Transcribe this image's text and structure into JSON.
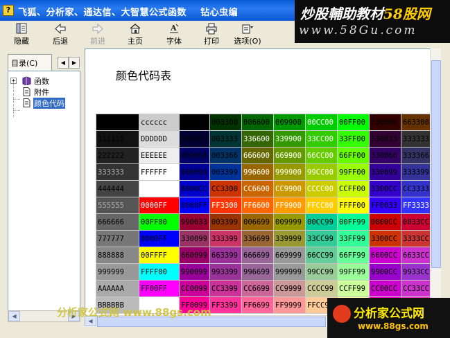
{
  "window": {
    "app_icon": "?",
    "title": "飞狐、分析家、通达信、大智慧公式函数    钻心虫编"
  },
  "banner": {
    "line1_a": "炒股輔助教材",
    "line1_b": "58股网",
    "line2": "www.58Gu.com"
  },
  "toolbar": {
    "items": [
      {
        "label": "隐藏",
        "icon": "hide-icon",
        "enabled": true
      },
      {
        "label": "后退",
        "icon": "back-arrow-icon",
        "enabled": true
      },
      {
        "label": "前进",
        "icon": "forward-arrow-icon",
        "enabled": false
      },
      {
        "label": "主页",
        "icon": "home-icon",
        "enabled": true
      },
      {
        "label": "字体",
        "icon": "font-icon",
        "enabled": true
      },
      {
        "label": "打印",
        "icon": "print-icon",
        "enabled": true
      },
      {
        "label": "选项(O)",
        "icon": "options-icon",
        "enabled": true
      }
    ]
  },
  "sidebar": {
    "tab_label": "目录(C)",
    "tree": [
      {
        "label": "函数",
        "icon": "book-icon",
        "expandable": true,
        "selected": false
      },
      {
        "label": "附件",
        "icon": "page-icon",
        "expandable": false,
        "selected": false
      },
      {
        "label": "颜色代码",
        "icon": "page-icon",
        "expandable": false,
        "selected": true
      }
    ]
  },
  "content": {
    "title": "颜色代码表",
    "rows": [
      [
        [
          "",
          "#000000",
          "#000"
        ],
        [
          "cccccc",
          "#cccccc",
          "#000"
        ],
        [
          "",
          "#000000",
          "#000"
        ],
        [
          "003300",
          "#003300",
          "#000"
        ],
        [
          "006600",
          "#006600",
          "#000"
        ],
        [
          "009900",
          "#009900",
          "#000"
        ],
        [
          "00CC00",
          "#00cc00",
          "#fff"
        ],
        [
          "00FF00",
          "#00ff00",
          "#000"
        ],
        [
          "330000",
          "#330000",
          "#000"
        ],
        [
          "663300",
          "#663300",
          "#000"
        ]
      ],
      [
        [
          "111111",
          "#111111",
          "#000"
        ],
        [
          "DDDDDD",
          "#dddddd",
          "#000"
        ],
        [
          "000033",
          "#000033",
          "#000"
        ],
        [
          "003333",
          "#003333",
          "#000"
        ],
        [
          "336600",
          "#336600",
          "#fff"
        ],
        [
          "339900",
          "#339900",
          "#fff"
        ],
        [
          "33CC00",
          "#33cc00",
          "#fff"
        ],
        [
          "33FF00",
          "#33ff00",
          "#000"
        ],
        [
          "330033",
          "#330033",
          "#000"
        ],
        [
          "333333",
          "#333333",
          "#000"
        ]
      ],
      [
        [
          "222222",
          "#222222",
          "#000"
        ],
        [
          "EEEEEE",
          "#eeeeee",
          "#000"
        ],
        [
          "000066",
          "#000066",
          "#000"
        ],
        [
          "003366",
          "#003366",
          "#000"
        ],
        [
          "666600",
          "#666600",
          "#fff"
        ],
        [
          "669900",
          "#669900",
          "#fff"
        ],
        [
          "66CC00",
          "#66cc00",
          "#fff"
        ],
        [
          "66FF00",
          "#66ff00",
          "#000"
        ],
        [
          "330066",
          "#330066",
          "#000"
        ],
        [
          "333366",
          "#333366",
          "#000"
        ]
      ],
      [
        [
          "333333",
          "#333333",
          "#aaa"
        ],
        [
          "FFFFFF",
          "#ffffff",
          "#000"
        ],
        [
          "000099",
          "#000099",
          "#000"
        ],
        [
          "003399",
          "#003399",
          "#000"
        ],
        [
          "996600",
          "#996600",
          "#fff"
        ],
        [
          "999900",
          "#999900",
          "#fff"
        ],
        [
          "99CC00",
          "#99cc00",
          "#fff"
        ],
        [
          "99FF00",
          "#99ff00",
          "#000"
        ],
        [
          "330099",
          "#330099",
          "#000"
        ],
        [
          "333399",
          "#333399",
          "#000"
        ]
      ],
      [
        [
          "444444",
          "#444444",
          "#000"
        ],
        [
          "",
          "#ffffff",
          "#000"
        ],
        [
          "0000CC",
          "#0000cc",
          "#000"
        ],
        [
          "CC3300",
          "#cc3300",
          "#000"
        ],
        [
          "CC6600",
          "#cc6600",
          "#fff"
        ],
        [
          "CC9900",
          "#cc9900",
          "#fff"
        ],
        [
          "CCCC00",
          "#cccc00",
          "#fff"
        ],
        [
          "CCFF00",
          "#ccff00",
          "#000"
        ],
        [
          "3300CC",
          "#3300cc",
          "#000"
        ],
        [
          "CC3333",
          "#3333cc",
          "#000"
        ]
      ],
      [
        [
          "555555",
          "#555555",
          "#aaa"
        ],
        [
          "0000FF",
          "#ff0000",
          "#fff"
        ],
        [
          "0000FF",
          "#0000ff",
          "#000"
        ],
        [
          "FF3300",
          "#ff3300",
          "#fff"
        ],
        [
          "FF6600",
          "#ff6600",
          "#fff"
        ],
        [
          "FF9900",
          "#ff9900",
          "#fff"
        ],
        [
          "FFCC00",
          "#ffcc00",
          "#fff"
        ],
        [
          "FFFF00",
          "#ffff00",
          "#000"
        ],
        [
          "FF0033",
          "#3300ff",
          "#000"
        ],
        [
          "FF3333",
          "#3333ff",
          "#fff"
        ]
      ],
      [
        [
          "666666",
          "#666666",
          "#000"
        ],
        [
          "00FF00",
          "#00ff00",
          "#000"
        ],
        [
          "990033",
          "#990033",
          "#000"
        ],
        [
          "003399",
          "#993300",
          "#000"
        ],
        [
          "006699",
          "#996600",
          "#000"
        ],
        [
          "009999",
          "#999900",
          "#000"
        ],
        [
          "00CC99",
          "#00cc99",
          "#000"
        ],
        [
          "00FF99",
          "#00ff99",
          "#000"
        ],
        [
          "0000CC",
          "#cc0000",
          "#000"
        ],
        [
          "0033CC",
          "#cc0033",
          "#000"
        ]
      ],
      [
        [
          "777777",
          "#777777",
          "#000"
        ],
        [
          "0000FF",
          "#0000ff",
          "#000"
        ],
        [
          "330099",
          "#993366",
          "#000"
        ],
        [
          "333399",
          "#cc3366",
          "#000"
        ],
        [
          "336699",
          "#996633",
          "#000"
        ],
        [
          "339999",
          "#999933",
          "#000"
        ],
        [
          "33CC99",
          "#33cc99",
          "#000"
        ],
        [
          "33FF99",
          "#33ff99",
          "#000"
        ],
        [
          "3300CC",
          "#cc3300",
          "#000"
        ],
        [
          "3333CC",
          "#cc3333",
          "#000"
        ]
      ],
      [
        [
          "888888",
          "#888888",
          "#000"
        ],
        [
          "00FFFF",
          "#ffff00",
          "#000"
        ],
        [
          "660099",
          "#990066",
          "#000"
        ],
        [
          "663399",
          "#993399",
          "#000"
        ],
        [
          "666699",
          "#996699",
          "#000"
        ],
        [
          "669999",
          "#999999",
          "#000"
        ],
        [
          "66CC99",
          "#66cc99",
          "#000"
        ],
        [
          "66FF99",
          "#66ff99",
          "#000"
        ],
        [
          "6600CC",
          "#cc00cc",
          "#000"
        ],
        [
          "6633CC",
          "#cc33cc",
          "#000"
        ]
      ],
      [
        [
          "999999",
          "#999999",
          "#000"
        ],
        [
          "FFFF00",
          "#00ffff",
          "#000"
        ],
        [
          "990099",
          "#990099",
          "#000"
        ],
        [
          "993399",
          "#993399",
          "#000"
        ],
        [
          "996699",
          "#996699",
          "#000"
        ],
        [
          "999999",
          "#999999",
          "#000"
        ],
        [
          "99CC99",
          "#99cc99",
          "#000"
        ],
        [
          "99FF99",
          "#99ff99",
          "#000"
        ],
        [
          "9900CC",
          "#9900cc",
          "#000"
        ],
        [
          "9933CC",
          "#9933cc",
          "#000"
        ]
      ],
      [
        [
          "AAAAAA",
          "#aaaaaa",
          "#000"
        ],
        [
          "FF00FF",
          "#ff00ff",
          "#000"
        ],
        [
          "CC0099",
          "#cc0099",
          "#000"
        ],
        [
          "CC3399",
          "#cc3399",
          "#000"
        ],
        [
          "CC6699",
          "#cc6699",
          "#000"
        ],
        [
          "CC9999",
          "#cc9999",
          "#000"
        ],
        [
          "CCCC99",
          "#cccc99",
          "#000"
        ],
        [
          "CCFF99",
          "#ccff99",
          "#000"
        ],
        [
          "CC00CC",
          "#cc00cc",
          "#000"
        ],
        [
          "CC33CC",
          "#cc33cc",
          "#000"
        ]
      ],
      [
        [
          "BBBBBB",
          "#bbbbbb",
          "#000"
        ],
        [
          "",
          "#ffffff",
          "#000"
        ],
        [
          "FF0099",
          "#ff0099",
          "#000"
        ],
        [
          "FF3399",
          "#ff3399",
          "#000"
        ],
        [
          "FF6699",
          "#ff6699",
          "#000"
        ],
        [
          "FF9999",
          "#ff9999",
          "#000"
        ],
        [
          "FFCC99",
          "#ffcc99",
          "#000"
        ],
        [
          "FFFF99",
          "#ffff99",
          "#000"
        ],
        [
          "FF00CC",
          "#ff00cc",
          "#000"
        ],
        [
          "FF33CC",
          "#ff33cc",
          "#000"
        ]
      ]
    ]
  },
  "watermark_left": "分析家公式网 www.88gs.com",
  "watermark_right": {
    "line1": "分析家公式网",
    "line2": "www.88gs.com"
  }
}
